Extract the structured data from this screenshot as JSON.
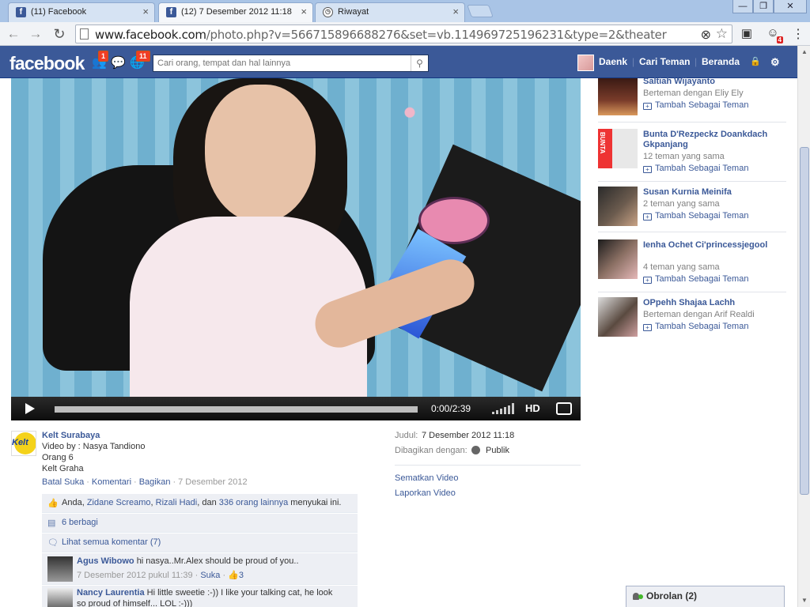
{
  "browser": {
    "tabs": [
      {
        "title": "(11) Facebook",
        "icon": "facebook-icon"
      },
      {
        "title": "(12) 7 Desember 2012 11:18",
        "icon": "facebook-icon"
      },
      {
        "title": "Riwayat",
        "icon": "clock-icon"
      }
    ],
    "url_domain": "www.facebook.com",
    "url_path": "/photo.php?v=566715896688276&set=vb.114969725196231&type=2&theater",
    "extension_badge": "4"
  },
  "fb": {
    "logo": "facebook",
    "friend_requests_count": "1",
    "notifications_count": "11",
    "search_placeholder": "Cari orang, tempat dan hal lainnya",
    "nav": {
      "profile_name": "Daenk",
      "find_friends": "Cari Teman",
      "home": "Beranda"
    }
  },
  "video": {
    "time": "0:00/2:39",
    "hd_label": "HD"
  },
  "suggestions": [
    {
      "name": "Saltiah Wijayanto",
      "sub": "Berteman dengan Eliy Ely",
      "add": "Tambah Sebagai Teman"
    },
    {
      "name": "Bunta D'Rezpeckz Doankdach Gkpanjang",
      "sub": "12 teman yang sama",
      "add": "Tambah Sebagai Teman",
      "pic_text": "BUNTA"
    },
    {
      "name": "Susan Kurnia Meinifa",
      "sub": "2 teman yang sama",
      "add": "Tambah Sebagai Teman"
    },
    {
      "name": "Ienha Ochet Ci'princessjegool",
      "sub": "4 teman yang sama",
      "add": "Tambah Sebagai Teman"
    },
    {
      "name": "OPpehh Shajaa Lachh",
      "sub": "Berteman dengan Arif Realdi",
      "add": "Tambah Sebagai Teman"
    }
  ],
  "caption": {
    "uploader": "Kelt Surabaya",
    "logo_text": "Kelt",
    "line1": "Video by : Nasya Tandiono",
    "line2": "Orang 6",
    "line3": "Kelt Graha",
    "unlike": "Batal Suka",
    "comment": "Komentari",
    "share": "Bagikan",
    "date": "7 Desember 2012"
  },
  "ufi": {
    "likes_prefix": "Anda,",
    "like_name1": "Zidane Screamo",
    "like_name2": "Rizali Hadi",
    "likes_and": ", dan",
    "likes_others": "336 orang lainnya",
    "likes_suffix": "menyukai ini.",
    "shares": "6 berbagi",
    "view_comments": "Lihat semua komentar (7)",
    "comments": [
      {
        "author": "Agus Wibowo",
        "text": "hi nasya..Mr.Alex should be proud of you..",
        "time": "7 Desember 2012 pukul 11:39",
        "like": "Suka",
        "like_count": "3"
      },
      {
        "author": "Nancy Laurentia",
        "text": "Hi little sweetie :-)) I like your talking cat, he look",
        "text2": "so proud of himself... LOL :-)))"
      }
    ]
  },
  "info": {
    "title_label": "Judul:",
    "title_value": "7 Desember 2012 11:18",
    "shared_label": "Dibagikan dengan:",
    "shared_value": "Publik",
    "embed": "Sematkan Video",
    "report": "Laporkan Video"
  },
  "chat": {
    "label": "Obrolan (2)"
  }
}
